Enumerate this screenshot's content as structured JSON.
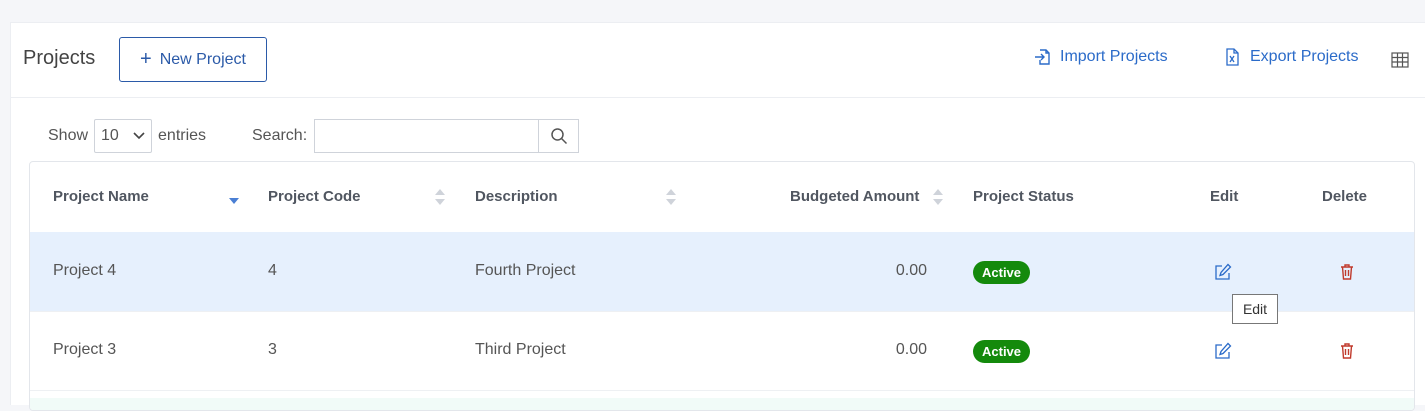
{
  "header": {
    "title": "Projects",
    "new_project_label": "New Project",
    "import_label": "Import Projects",
    "export_label": "Export Projects"
  },
  "controls": {
    "show_label": "Show",
    "page_size": "10",
    "entries_label": "entries",
    "search_label": "Search:",
    "search_value": ""
  },
  "table": {
    "columns": [
      "Project Name",
      "Project Code",
      "Description",
      "Budgeted Amount",
      "Project Status",
      "Edit",
      "Delete"
    ],
    "sort_column": "Project Name",
    "sort_direction": "descending",
    "rows": [
      {
        "name": "Project 4",
        "code": "4",
        "description": "Fourth Project",
        "budget": "0.00",
        "status": "Active",
        "highlighted": true
      },
      {
        "name": "Project 3",
        "code": "3",
        "description": "Third Project",
        "budget": "0.00",
        "status": "Active",
        "highlighted": false
      }
    ]
  },
  "tooltip": {
    "text": "Edit"
  },
  "icons": {
    "plus": "plus-icon",
    "import": "import-icon",
    "export": "excel-file-icon",
    "columns": "table-columns-icon",
    "search": "search-icon",
    "edit": "edit-icon",
    "delete": "trash-icon"
  },
  "colors": {
    "accent": "#2b5aa8",
    "link": "#2b6bc9",
    "status_active": "#148a0c",
    "row_highlight": "#e6f0fd",
    "delete": "#c0392b"
  }
}
